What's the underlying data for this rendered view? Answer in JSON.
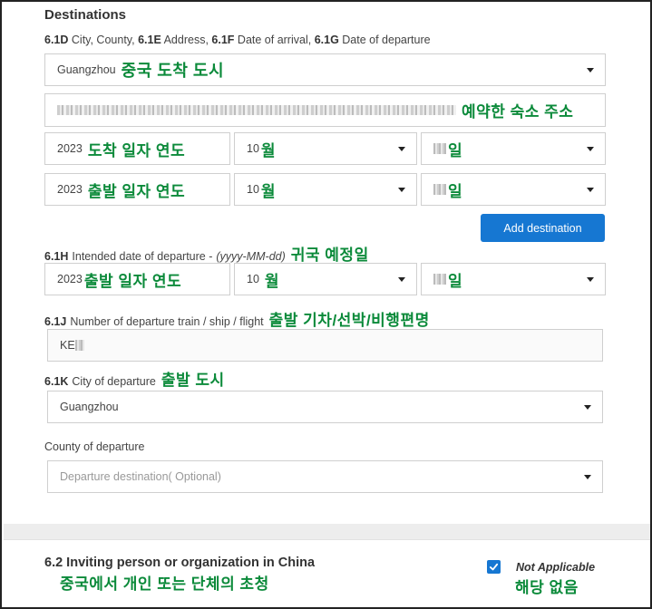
{
  "section": {
    "title": "Destinations",
    "fields_line": [
      {
        "code": "6.1D",
        "text": "City, County,"
      },
      {
        "code": "6.1E",
        "text": "Address,"
      },
      {
        "code": "6.1F",
        "text": "Date of arrival,"
      },
      {
        "code": "6.1G",
        "text": "Date of departure"
      }
    ]
  },
  "city_select": {
    "value": "Guangzhou",
    "annotation": "중국 도착 도시"
  },
  "address_field": {
    "annotation": "예약한 숙소 주소"
  },
  "arrival_date": {
    "year": "2023",
    "year_annotation": "도착 일자 연도",
    "month": "10",
    "month_annotation": "월",
    "day_annotation": "일"
  },
  "departure_date": {
    "year": "2023",
    "year_annotation": "출발 일자 연도",
    "month": "10",
    "month_annotation": "월",
    "day_annotation": "일"
  },
  "add_destination_label": "Add destination",
  "intended_departure": {
    "code": "6.1H",
    "label": "Intended date of departure -",
    "format": "(yyyy-MM-dd)",
    "annotation": "귀국 예정일",
    "year": "2023",
    "year_annotation": "출발 일자 연도",
    "month": "10",
    "month_annotation": "월",
    "day_annotation": "일"
  },
  "departure_number": {
    "code": "6.1J",
    "label": "Number of departure train / ship / flight",
    "annotation": "출발 기차/선박/비행편명",
    "value_prefix": "KE"
  },
  "departure_city": {
    "code": "6.1K",
    "label": "City of departure",
    "annotation": "출발 도시",
    "value": "Guangzhou"
  },
  "departure_county": {
    "label": "County of departure",
    "placeholder": "Departure destination( Optional)"
  },
  "inviting": {
    "title": "6.2 Inviting person or organization in China",
    "annotation": "중국에서 개인 또는 단체의 초청",
    "not_applicable_label": "Not Applicable",
    "not_applicable_annotation": "해당 없음",
    "not_applicable_checked": true
  },
  "colors": {
    "accent": "#1677d2",
    "annotation": "#0b8a3a",
    "border": "#cfcfcf"
  }
}
